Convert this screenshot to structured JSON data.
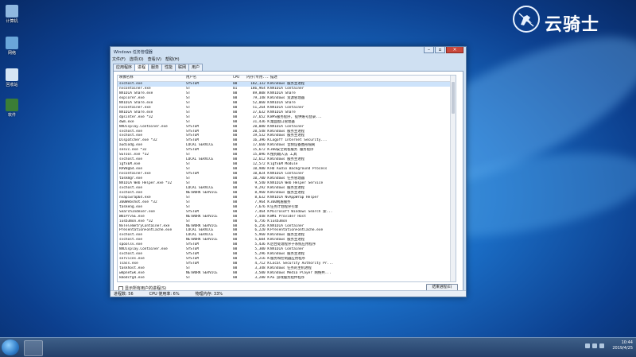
{
  "desktop": {
    "icons": [
      {
        "label": "计算机",
        "color": "#8fb8e0"
      },
      {
        "label": "网络",
        "color": "#6aa6da"
      },
      {
        "label": "回收站",
        "color": "#d6e6f5"
      },
      {
        "label": "软件",
        "color": "#3b7d36"
      }
    ],
    "logo_text": "云骑士"
  },
  "window": {
    "title": "Windows 任务管理器",
    "menu": [
      "文件(F)",
      "选项(O)",
      "查看(V)",
      "帮助(H)"
    ],
    "tabs": [
      "应用程序",
      "进程",
      "服务",
      "性能",
      "联网",
      "用户"
    ],
    "active_tab": 1,
    "columns": [
      "映像名称",
      "用户名",
      "CPU",
      "内存(专用...",
      "描述"
    ],
    "rows": [
      [
        "svchost.exe",
        "SYSTEM",
        "00",
        "182,132 K",
        "Windows 服务主进程"
      ],
      [
        "nvcontainer.exe",
        "ST",
        "01",
        "186,964 K",
        "NVIDIA Container"
      ],
      [
        "NVIDIA Share.exe",
        "ST",
        "00",
        "89,808 K",
        "NVIDIA Share"
      ],
      [
        "explorer.exe",
        "ST",
        "00",
        "79,148 K",
        "Windows 资源管理器"
      ],
      [
        "NVIDIA Share.exe",
        "ST",
        "00",
        "52,060 K",
        "NVIDIA Share"
      ],
      [
        "nvcontainer.exe",
        "ST",
        "00",
        "51,264 K",
        "NVIDIA Container"
      ],
      [
        "NVIDIA Share.exe",
        "ST",
        "00",
        "37,632 K",
        "NVIDIA Share"
      ],
      [
        "dpsinter.exe *32",
        "ST",
        "00",
        "37,652 K",
        "WPS服务程序, 提供账号登录..."
      ],
      [
        "dwm.exe",
        "ST",
        "00",
        "31,436 K",
        "桌面窗口管理器"
      ],
      [
        "NVDisplay.Container.exe",
        "SYSTEM",
        "00",
        "20,080 K",
        "NVIDIA Container"
      ],
      [
        "svchost.exe",
        "SYSTEM",
        "00",
        "20,548 K",
        "Windows 服务主进程"
      ],
      [
        "svchost.exe",
        "SYSTEM",
        "00",
        "19,532 K",
        "Windows 服务主进程"
      ],
      [
        "Dispatcher.exe *32",
        "SYSTEM",
        "00",
        "16,396 K",
        "Logoff Internet Security..."
      ],
      [
        "audiodg.exe",
        "LOCAL SERVICE",
        "00",
        "17,660 K",
        "Windows 音频设备图形隔离"
      ],
      [
        "sesvc.exe *32",
        "SYSTEM",
        "00",
        "15,672 K",
        "360安全刺客服务 服务程序"
      ],
      [
        "SGTool.exe *32",
        "ST",
        "00",
        "15,096 K",
        "搜狗输入法 工具"
      ],
      [
        "svchost.exe",
        "LOCAL SERVICE",
        "00",
        "12,612 K",
        "Windows 服务主进程"
      ],
      [
        "igfxEM.exe",
        "ST",
        "00",
        "12,572 K",
        "igfxEM Module"
      ],
      [
        "RAVBg64.exe",
        "ST",
        "00",
        "10,980 K",
        "HD Audio Background Process"
      ],
      [
        "nvcontainer.exe",
        "SYSTEM",
        "00",
        "10,824 K",
        "NVIDIA Container"
      ],
      [
        "taskmgr.exe",
        "ST",
        "00",
        "10,700 K",
        "Windows 任务管理器"
      ],
      [
        "NVIDIA Web Helper.exe *32",
        "ST",
        "00",
        "9,540 K",
        "NVIDIA Web Helper Service"
      ],
      [
        "svchost.exe",
        "LOCAL SERVICE",
        "00",
        "9,292 K",
        "Windows 服务主进程"
      ],
      [
        "svchost.exe",
        "NETWORK SERVICE",
        "00",
        "8,960 K",
        "Windows 服务主进程"
      ],
      [
        "nvapiwrap64.exe",
        "ST",
        "00",
        "8,632 K",
        "NVIDIA NvAppWrap Helper"
      ],
      [
        "360Webshot.exe *32",
        "ST",
        "00",
        "7,964 K",
        "360网盾服务"
      ],
      [
        "taskeng.exe",
        "ST",
        "00",
        "7,676 K",
        "任务计划程序引擎"
      ],
      [
        "SearchIndexer.exe",
        "SYSTEM",
        "00",
        "7,464 K",
        "Microsoft Windows Search 索..."
      ],
      [
        "WmiPrvSE.exe",
        "NETWORK SERVICE",
        "00",
        "7,448 K",
        "WMI Provider Host"
      ],
      [
        "iusb3mon.exe *32",
        "ST",
        "00",
        "6,756 K",
        "iusb3mon"
      ],
      [
        "NvTelemetryContainer.exe",
        "NETWORK SERVICE",
        "00",
        "6,256 K",
        "NVIDIA Container"
      ],
      [
        "PresentationFontCache.exe",
        "LOCAL SERVICE",
        "00",
        "6,220 K",
        "PresentationFontCache.exe"
      ],
      [
        "svchost.exe",
        "LOCAL SERVICE",
        "00",
        "5,960 K",
        "Windows 服务主进程"
      ],
      [
        "svchost.exe",
        "NETWORK SERVICE",
        "00",
        "5,604 K",
        "Windows 服务主进程"
      ],
      [
        "spoolsv.exe",
        "SYSTEM",
        "00",
        "5,436 K",
        "后台处理程序子系统应用程序"
      ],
      [
        "NVDisplay.Container.exe",
        "SYSTEM",
        "00",
        "5,300 K",
        "NVIDIA Container"
      ],
      [
        "svchost.exe",
        "SYSTEM",
        "00",
        "5,296 K",
        "Windows 服务主进程"
      ],
      [
        "services.exe",
        "SYSTEM",
        "00",
        "5,216 K",
        "服务和控制器应用程序"
      ],
      [
        "lsass.exe",
        "SYSTEM",
        "00",
        "4,712 K",
        "Local Security Authority Pr..."
      ],
      [
        "taskhost.exe",
        "ST",
        "00",
        "3,348 K",
        "Windows 任务的主机进程"
      ],
      [
        "wmpnetwk.exe",
        "NETWORK SERVICE",
        "00",
        "3,500 K",
        "Windows Media Player 网络共..."
      ],
      [
        "kmodcfg4.exe",
        "ST",
        "00",
        "3,280 K",
        "AS 游戏服务组件程序"
      ]
    ],
    "show_all_label": "显示所有用户的进程(S)",
    "end_button": "结束进程(E)",
    "status": {
      "processes": "进程数: 56",
      "cpu": "CPU 使用率: 6%",
      "memory": "物理内存: 33%"
    }
  },
  "taskbar": {
    "time": "10:44",
    "date": "2019/4/25"
  },
  "colors": {
    "desktop": "#1a6cc4",
    "selection": "#cde3fb",
    "close_button": "#c9483c"
  }
}
